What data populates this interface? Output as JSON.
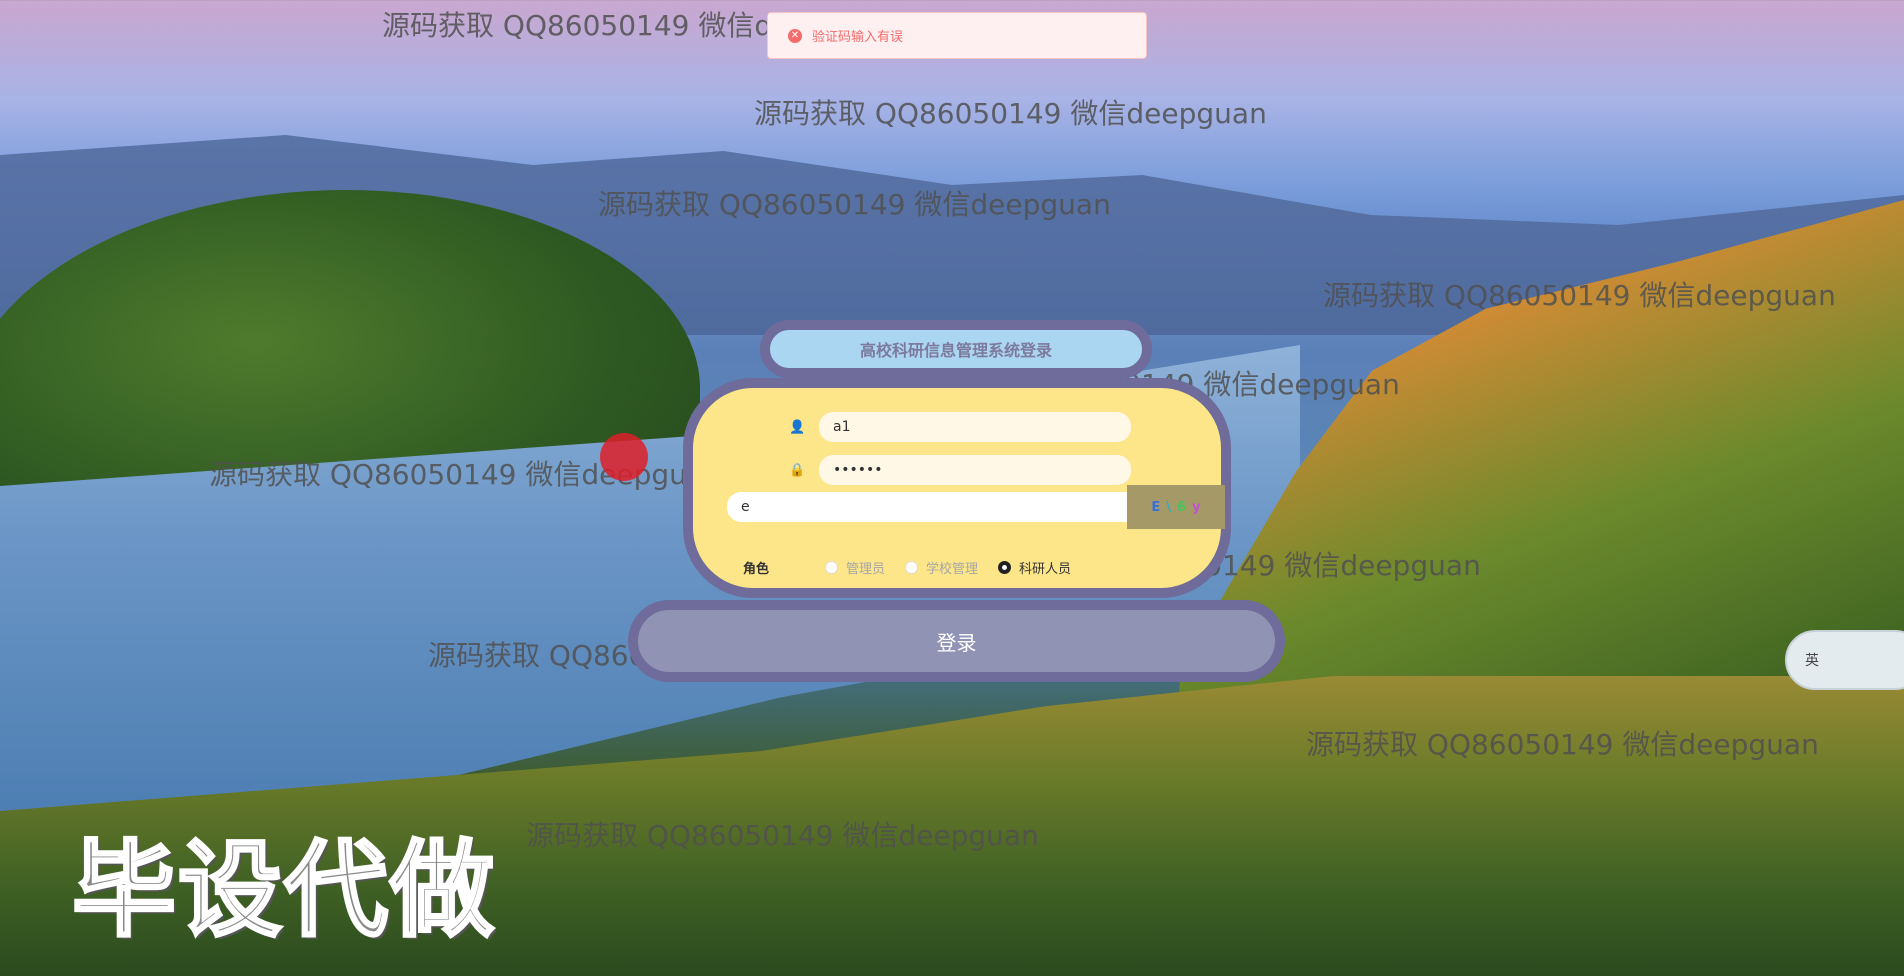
{
  "toast": {
    "icon": "error-icon",
    "message": "验证码输入有误"
  },
  "login": {
    "title": "高校科研信息管理系统登录",
    "username_icon": "user-icon",
    "username_value": "a1",
    "password_icon": "lock-icon",
    "password_value": "••••••",
    "captcha_value": "e",
    "captcha_chars": [
      "E",
      "\\",
      "6",
      "y"
    ],
    "role_label": "角色",
    "roles": [
      {
        "label": "管理员",
        "checked": false
      },
      {
        "label": "学校管理",
        "checked": false
      },
      {
        "label": "科研人员",
        "checked": true
      }
    ],
    "button_label": "登录"
  },
  "watermark_text": "源码获取 QQ86050149 微信deepguan",
  "stamp_text": "毕设代做",
  "ime": {
    "label": "英"
  }
}
